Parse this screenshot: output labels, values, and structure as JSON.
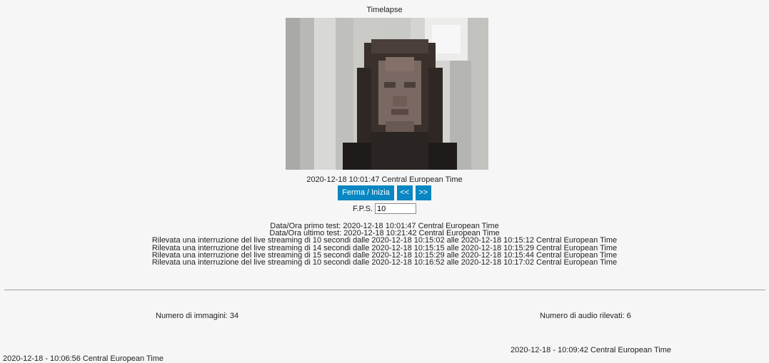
{
  "page": {
    "title": "Timelapse"
  },
  "viewer": {
    "timestamp": "2020-12-18 10:01:47 Central European Time",
    "buttons": {
      "play_pause": "Ferma / Inizia",
      "prev": "<<",
      "next": ">>"
    },
    "fps_label": "F.P.S.",
    "fps_value": "10"
  },
  "log": {
    "lines": [
      "Data/Ora primo test: 2020-12-18 10:01:47 Central European Time",
      "Data/Ora ultimo test: 2020-12-18 10:21:42 Central European Time",
      "Rilevata una interruzione del live streaming di 10 secondi dalle 2020-12-18 10:15:02 alle 2020-12-18 10:15:12 Central European Time",
      "Rilevata una interruzione del live streaming di 14 secondi dalle 2020-12-18 10:15:15 alle 2020-12-18 10:15:29 Central European Time",
      "Rilevata una interruzione del live streaming di 15 secondi dalle 2020-12-18 10:15:29 alle 2020-12-18 10:15:44 Central European Time",
      "Rilevata una interruzione del live streaming di 10 secondi dalle 2020-12-18 10:16:52 alle 2020-12-18 10:17:02 Central European Time"
    ]
  },
  "summary": {
    "images_count": "Numero di immagini: 34",
    "audio_count": "Numero di audio rilevati: 6",
    "first_image_time": "2020-12-18 - 10:06:56 Central European Time",
    "first_audio_time": "2020-12-18 - 10:09:42 Central European Time"
  },
  "colors": {
    "button_bg": "#0a87c2",
    "page_bg": "#f6f6f6"
  }
}
